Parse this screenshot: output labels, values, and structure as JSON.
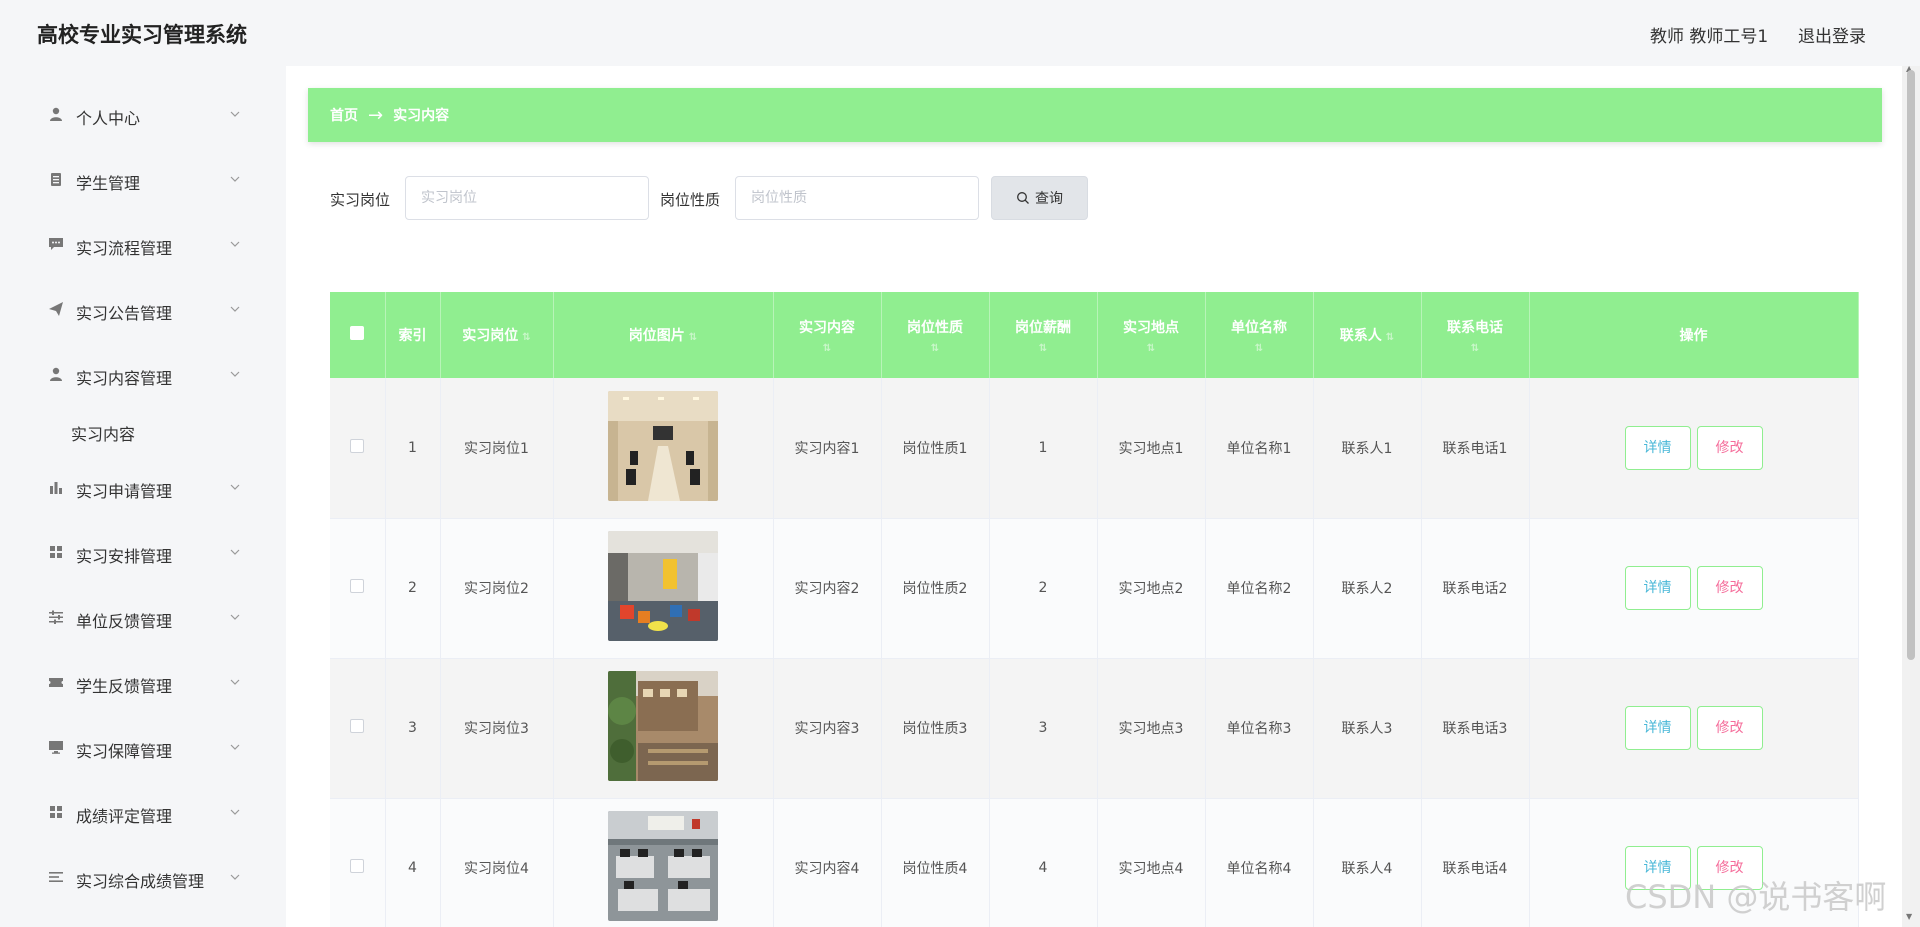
{
  "app": {
    "title": "高校专业实习管理系统"
  },
  "header": {
    "user": "教师 教师工号1",
    "logout": "退出登录"
  },
  "sidebar": {
    "items": [
      {
        "label": "个人中心",
        "icon": "user-icon"
      },
      {
        "label": "学生管理",
        "icon": "clipboard-icon"
      },
      {
        "label": "实习流程管理",
        "icon": "chat-icon"
      },
      {
        "label": "实习公告管理",
        "icon": "send-icon"
      },
      {
        "label": "实习内容管理",
        "icon": "user-icon"
      },
      {
        "label": "实习申请管理",
        "icon": "bar-chart-icon"
      },
      {
        "label": "实习安排管理",
        "icon": "grid-icon"
      },
      {
        "label": "单位反馈管理",
        "icon": "sliders-icon"
      },
      {
        "label": "学生反馈管理",
        "icon": "ticket-icon"
      },
      {
        "label": "实习保障管理",
        "icon": "monitor-icon"
      },
      {
        "label": "成绩评定管理",
        "icon": "grid-icon"
      },
      {
        "label": "实习综合成绩管理",
        "icon": "list-icon"
      }
    ],
    "submenu": {
      "label": "实习内容"
    }
  },
  "breadcrumb": {
    "home": "首页",
    "current": "实习内容"
  },
  "search": {
    "field1_label": "实习岗位",
    "field1_placeholder": "实习岗位",
    "field2_label": "岗位性质",
    "field2_placeholder": "岗位性质",
    "button": "查询"
  },
  "table": {
    "columns": [
      "索引",
      "实习岗位",
      "岗位图片",
      "实习内容",
      "岗位性质",
      "岗位薪酬",
      "实习地点",
      "单位名称",
      "联系人",
      "联系电话",
      "操作"
    ],
    "rows": [
      {
        "index": "1",
        "post": "实习岗位1",
        "content": "实习内容1",
        "nature": "岗位性质1",
        "salary": "1",
        "place": "实习地点1",
        "unit": "单位名称1",
        "contact": "联系人1",
        "phone": "联系电话1"
      },
      {
        "index": "2",
        "post": "实习岗位2",
        "content": "实习内容2",
        "nature": "岗位性质2",
        "salary": "2",
        "place": "实习地点2",
        "unit": "单位名称2",
        "contact": "联系人2",
        "phone": "联系电话2"
      },
      {
        "index": "3",
        "post": "实习岗位3",
        "content": "实习内容3",
        "nature": "岗位性质3",
        "salary": "3",
        "place": "实习地点3",
        "unit": "单位名称3",
        "contact": "联系人3",
        "phone": "联系电话3"
      },
      {
        "index": "4",
        "post": "实习岗位4",
        "content": "实习内容4",
        "nature": "岗位性质4",
        "salary": "4",
        "place": "实习地点4",
        "unit": "单位名称4",
        "contact": "联系人4",
        "phone": "联系电话4"
      }
    ],
    "actions": {
      "detail": "详情",
      "edit": "修改"
    }
  },
  "watermark": "CSDN @说书客啊",
  "colors": {
    "accent": "#90ee90",
    "detail_text": "#4ab8d8",
    "edit_text": "#f56c9a"
  }
}
